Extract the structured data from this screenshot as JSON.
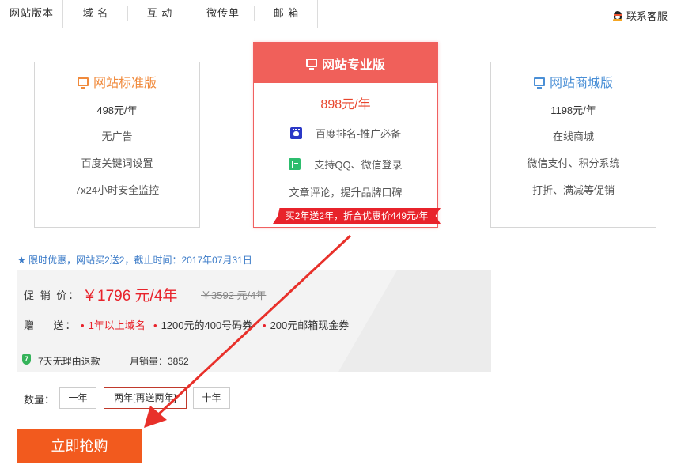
{
  "tabs": [
    "网站版本",
    "域 名",
    "互 动",
    "微传单",
    "邮 箱"
  ],
  "service": "联系客服",
  "plans": {
    "standard": {
      "title": "网站标准版",
      "price": "498元/年",
      "features": [
        "无广告",
        "百度关键词设置",
        "7x24小时安全监控"
      ]
    },
    "pro": {
      "title": "网站专业版",
      "price": "898元/年",
      "features": [
        "百度排名-推广必备",
        "支持QQ、微信登录",
        "文章评论，提升品牌口碑"
      ],
      "ribbon": "买2年送2年，折合优惠价449元/年"
    },
    "mall": {
      "title": "网站商城版",
      "price": "1198元/年",
      "features": [
        "在线商城",
        "微信支付、积分系统",
        "打折、满减等促销"
      ]
    }
  },
  "promo_note": "★ 限时优惠，网站买2送2，截止时间：2017年07月31日",
  "buy": {
    "price_label": "促 销 价：",
    "price": "￥1796 元/4年",
    "original_price": "￥3592 元/4年",
    "gift_label": "赠    送：",
    "gifts": [
      "1年以上域名",
      "1200元的400号码券",
      "200元邮箱现金券"
    ],
    "refund": "7天无理由退款",
    "monthly_sales": "月销量：3852"
  },
  "quantity": {
    "label": "数量：",
    "options": [
      "一年",
      "两年[再送两年]",
      "十年"
    ],
    "selected": "两年[再送两年]"
  },
  "buy_button": "立即抢购",
  "colors": {
    "accent": "#f0605a",
    "buy_button": "#f25a1e",
    "price_red": "#e8232b",
    "link_blue": "#3b7bc8"
  }
}
